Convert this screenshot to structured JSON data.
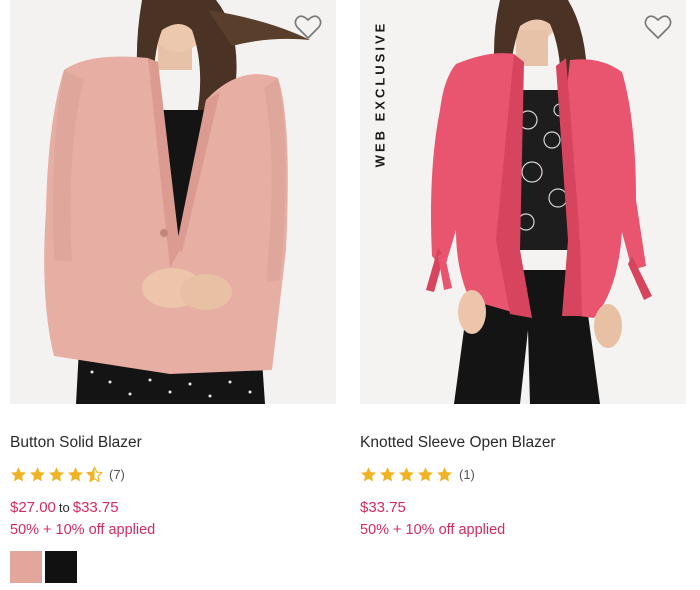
{
  "products": [
    {
      "name": "Button Solid Blazer",
      "rating": 4.5,
      "review_count": "(7)",
      "price_from": "$27.00",
      "price_to_word": "to",
      "price_to": "$33.75",
      "promo": "50% + 10% off applied",
      "swatches": [
        "#e2a69c",
        "#111111"
      ],
      "badge": ""
    },
    {
      "name": "Knotted Sleeve Open Blazer",
      "rating": 5,
      "review_count": "(1)",
      "price": "$33.75",
      "promo": "50% + 10% off applied",
      "badge": "WEB EXCLUSIVE"
    }
  ],
  "colors": {
    "price": "#d62a5e",
    "star": "#f2b322",
    "blazer_1": "#e7aea3",
    "blazer_2": "#e9546e"
  },
  "icons": {
    "wishlist": "heart-outline-icon",
    "rating": "star-icon"
  }
}
